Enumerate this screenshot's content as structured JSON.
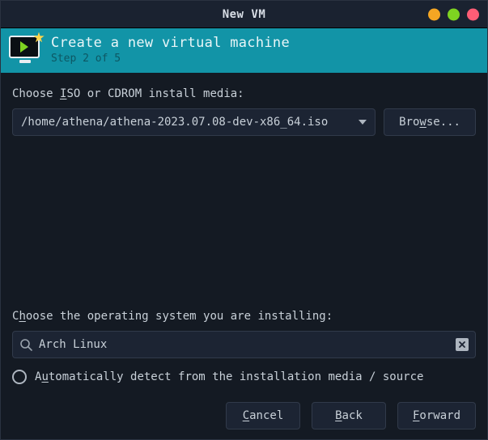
{
  "window": {
    "title": "New VM"
  },
  "header": {
    "title": "Create a new virtual machine",
    "step": "Step 2 of 5"
  },
  "iso": {
    "pre": "Choose ",
    "mnemonic": "I",
    "post": "SO or CDROM install media:",
    "value": "/home/athena/athena-2023.07.08-dev-x86_64.iso",
    "browse_pre": "Bro",
    "browse_mn": "w",
    "browse_post": "se..."
  },
  "os": {
    "pre": "C",
    "mnemonic": "h",
    "post": "oose the operating system you are installing:",
    "value": "Arch Linux",
    "auto_pre": "A",
    "auto_mn": "u",
    "auto_post": "tomatically detect from the installation media / source"
  },
  "footer": {
    "cancel_mn": "C",
    "cancel_post": "ancel",
    "back_mn": "B",
    "back_post": "ack",
    "forward_mn": "F",
    "forward_post": "orward"
  }
}
